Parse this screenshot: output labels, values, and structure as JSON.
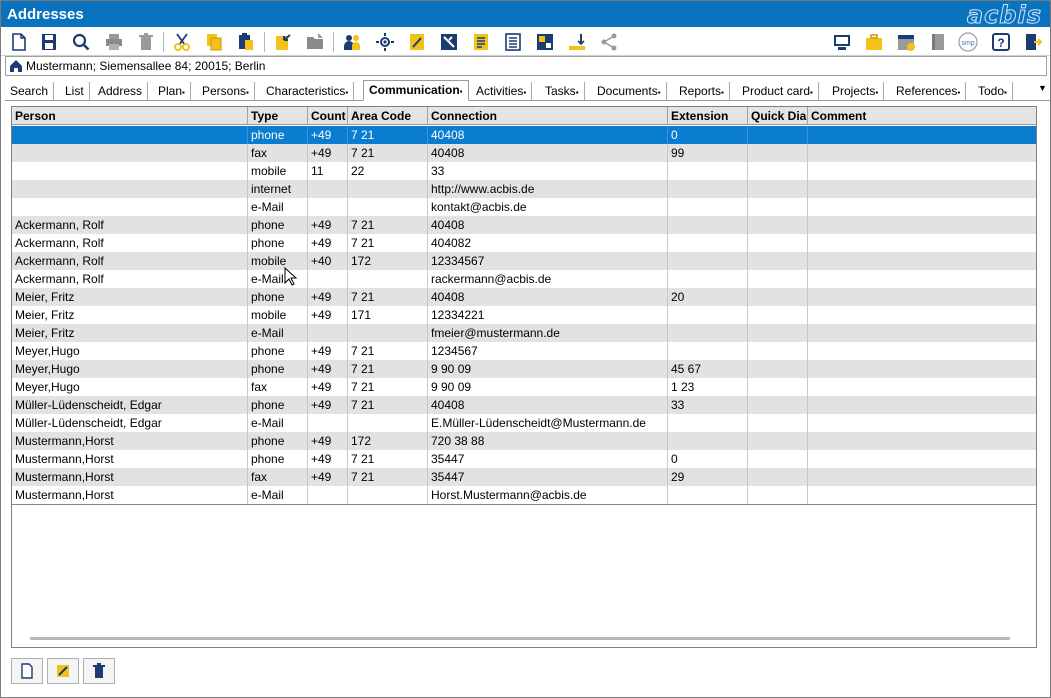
{
  "window": {
    "title": "Addresses",
    "brand": "acbis"
  },
  "toolbar": {
    "left_icons": [
      "new-document-icon",
      "save-icon",
      "search-icon",
      "print-icon",
      "delete-icon",
      "cut-icon",
      "copy-icon",
      "paste-icon",
      "import-icon",
      "open-folder-icon",
      "persons-icon",
      "view-icon",
      "edit-pencil-icon",
      "tools-icon",
      "notes-icon",
      "document-list-icon",
      "layout-icon",
      "measure-icon",
      "share-icon"
    ],
    "right_icons": [
      "monitor-icon",
      "briefcase-icon",
      "calendar-check-icon",
      "book-icon",
      "smp-icon",
      "help-icon",
      "exit-icon"
    ],
    "smp_label": "smp"
  },
  "address_bar": {
    "text": "Mustermann; Siemensallee 84; 20015; Berlin"
  },
  "tabs": [
    {
      "label": "Search",
      "marker": ""
    },
    {
      "label": "List",
      "marker": ""
    },
    {
      "label": "Address",
      "marker": ""
    },
    {
      "label": "Plan",
      "marker": "▪"
    },
    {
      "label": "Persons",
      "marker": "▪"
    },
    {
      "label": "Characteristics",
      "marker": "▪"
    },
    {
      "label": "Communication",
      "marker": "▪"
    },
    {
      "label": "Activities",
      "marker": "▪"
    },
    {
      "label": "Tasks",
      "marker": "▪"
    },
    {
      "label": "Documents",
      "marker": "▪"
    },
    {
      "label": "Reports",
      "marker": "▪"
    },
    {
      "label": "Product card",
      "marker": "▪"
    },
    {
      "label": "Projects",
      "marker": "▪"
    },
    {
      "label": "References",
      "marker": "▪"
    },
    {
      "label": "Todo",
      "marker": "▪"
    }
  ],
  "active_tab": "Communication",
  "grid": {
    "columns": [
      "Person",
      "Type",
      "Count",
      "Area Code",
      "Connection",
      "Extension",
      "Quick Dia",
      "Comment"
    ],
    "rows": [
      [
        "",
        "phone",
        "+49",
        "7 21",
        "40408",
        "0",
        "",
        ""
      ],
      [
        "",
        "fax",
        "+49",
        "7 21",
        "40408",
        "99",
        "",
        ""
      ],
      [
        "",
        "mobile",
        "11",
        "22",
        "33",
        "",
        "",
        ""
      ],
      [
        "",
        "internet",
        "",
        "",
        "http://www.acbis.de",
        "",
        "",
        ""
      ],
      [
        "",
        "e-Mail",
        "",
        "",
        "kontakt@acbis.de",
        "",
        "",
        ""
      ],
      [
        "Ackermann, Rolf",
        "phone",
        "+49",
        "7 21",
        "40408",
        "",
        "",
        ""
      ],
      [
        "Ackermann, Rolf",
        "phone",
        "+49",
        "7 21",
        "404082",
        "",
        "",
        ""
      ],
      [
        "Ackermann, Rolf",
        "mobile",
        "+40",
        "172",
        "12334567",
        "",
        "",
        ""
      ],
      [
        "Ackermann, Rolf",
        "e-Mail",
        "",
        "",
        "rackermann@acbis.de",
        "",
        "",
        ""
      ],
      [
        "Meier, Fritz",
        "phone",
        "+49",
        "7 21",
        "40408",
        "20",
        "",
        ""
      ],
      [
        "Meier, Fritz",
        "mobile",
        "+49",
        "171",
        "12334221",
        "",
        "",
        ""
      ],
      [
        "Meier, Fritz",
        "e-Mail",
        "",
        "",
        "fmeier@mustermann.de",
        "",
        "",
        ""
      ],
      [
        "Meyer,Hugo",
        "phone",
        "+49",
        "7 21",
        "1234567",
        "",
        "",
        ""
      ],
      [
        "Meyer,Hugo",
        "phone",
        "+49",
        "7 21",
        "9 90 09",
        "45 67",
        "",
        ""
      ],
      [
        "Meyer,Hugo",
        "fax",
        "+49",
        "7 21",
        "9 90 09",
        "1 23",
        "",
        ""
      ],
      [
        "Müller-Lüdenscheidt, Edgar",
        "phone",
        "+49",
        "7 21",
        "40408",
        "33",
        "",
        ""
      ],
      [
        "Müller-Lüdenscheidt, Edgar",
        "e-Mail",
        "",
        "",
        "E.Müller-Lüdenscheidt@Mustermann.de",
        "",
        "",
        ""
      ],
      [
        "Mustermann,Horst",
        "phone",
        "+49",
        "172",
        "720 38 88",
        "",
        "",
        ""
      ],
      [
        "Mustermann,Horst",
        "phone",
        "+49",
        "7 21",
        "35447",
        "0",
        "",
        ""
      ],
      [
        "Mustermann,Horst",
        "fax",
        "+49",
        "7 21",
        "35447",
        "29",
        "",
        ""
      ],
      [
        "Mustermann,Horst",
        "e-Mail",
        "",
        "",
        "Horst.Mustermann@acbis.de",
        "",
        "",
        ""
      ]
    ],
    "selected_row": 0
  },
  "bottom_buttons": [
    "new-record-icon",
    "edit-record-icon",
    "delete-record-icon"
  ],
  "colors": {
    "titlebar": "#0a73c0",
    "selection": "#0a7dd0",
    "stripe": "#e2e2e2",
    "accent_yellow": "#f2c21a"
  }
}
